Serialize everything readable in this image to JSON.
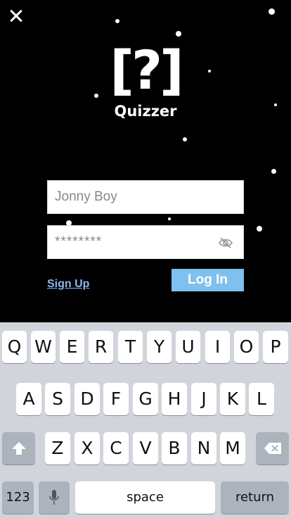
{
  "app": {
    "logo_text": "[?]",
    "name": "Quizzer"
  },
  "login": {
    "username_value": "Jonny Boy",
    "password_value": "********",
    "signup_label": "Sign Up",
    "login_label": "Log In"
  },
  "icons": {
    "close": "close-icon",
    "password_toggle": "eye-slash-icon",
    "shift": "shift-arrow-icon",
    "delete": "backspace-icon",
    "dictation": "microphone-icon"
  },
  "colors": {
    "background": "#000000",
    "accent": "#7ec0ee",
    "link": "#8ab8ee",
    "keyboard_bg": "#d1d5db"
  },
  "keyboard": {
    "row1": [
      "Q",
      "W",
      "E",
      "R",
      "T",
      "Y",
      "U",
      "I",
      "O",
      "P"
    ],
    "row2": [
      "A",
      "S",
      "D",
      "F",
      "G",
      "H",
      "J",
      "K",
      "L"
    ],
    "row3": [
      "Z",
      "X",
      "C",
      "V",
      "B",
      "N",
      "M"
    ],
    "numbers_label": "123",
    "space_label": "space",
    "return_label": "return"
  }
}
